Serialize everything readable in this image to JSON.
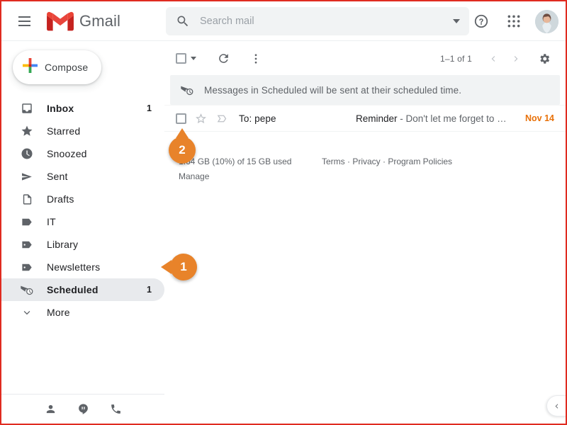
{
  "app": {
    "brand": "Gmail",
    "logo_color": "#d93025",
    "accent_orange": "#e8832a",
    "date_color": "#e8710a"
  },
  "header": {
    "menu_icon": "hamburger-icon",
    "logo_icon": "gmail-logo-icon",
    "search": {
      "icon": "search-icon",
      "placeholder": "Search mail",
      "value": "",
      "options_icon": "chevron-down-icon"
    },
    "help_icon": "help-icon",
    "apps_icon": "google-apps-grid-icon",
    "avatar_icon": "user-avatar"
  },
  "sidebar": {
    "compose": {
      "label": "Compose",
      "icon": "plus-icon"
    },
    "items": [
      {
        "label": "Inbox",
        "icon": "inbox-icon",
        "count": "1",
        "bold": true,
        "active": false
      },
      {
        "label": "Starred",
        "icon": "star-icon",
        "count": "",
        "bold": false,
        "active": false
      },
      {
        "label": "Snoozed",
        "icon": "clock-icon",
        "count": "",
        "bold": false,
        "active": false
      },
      {
        "label": "Sent",
        "icon": "send-icon",
        "count": "",
        "bold": false,
        "active": false
      },
      {
        "label": "Drafts",
        "icon": "draft-icon",
        "count": "",
        "bold": false,
        "active": false
      },
      {
        "label": "IT",
        "icon": "label-icon",
        "count": "",
        "bold": false,
        "active": false
      },
      {
        "label": "Library",
        "icon": "label-dot-icon",
        "count": "",
        "bold": false,
        "active": false
      },
      {
        "label": "Newsletters",
        "icon": "label-dot-icon",
        "count": "",
        "bold": false,
        "active": false
      },
      {
        "label": "Scheduled",
        "icon": "scheduled-icon",
        "count": "1",
        "bold": true,
        "active": true
      },
      {
        "label": "More",
        "icon": "chevron-down-icon",
        "count": "",
        "bold": false,
        "active": false
      }
    ],
    "bottom_icons": [
      {
        "name": "contacts-icon"
      },
      {
        "name": "hangouts-icon"
      },
      {
        "name": "phone-icon"
      }
    ]
  },
  "toolbar": {
    "select_all_icon": "checkbox-icon",
    "select_all_caret": "chevron-down-icon",
    "refresh_icon": "refresh-icon",
    "more_icon": "more-vertical-icon",
    "page_count": "1–1 of 1",
    "prev_icon": "chevron-left-icon",
    "next_icon": "chevron-right-icon",
    "settings_icon": "gear-icon"
  },
  "banner": {
    "icon": "scheduled-icon",
    "text": "Messages in Scheduled will be sent at their scheduled time."
  },
  "mail": {
    "row": {
      "checkbox_icon": "checkbox-icon",
      "star_icon": "star-outline-icon",
      "important_icon": "important-marker-icon",
      "recipient": "To: pepe",
      "subject": "Reminder",
      "snippet": " - Don't let me forget to …",
      "date": "Nov 14"
    }
  },
  "footer": {
    "storage": "1.64 GB (10%) of 15 GB used",
    "manage": "Manage",
    "links": "Terms · Privacy · Program Policies"
  },
  "callouts": [
    {
      "id": "1",
      "label": "1",
      "target": "sidebar-item-scheduled"
    },
    {
      "id": "2",
      "label": "2",
      "target": "mail-row-checkbox"
    }
  ],
  "expander": {
    "icon": "chevron-left-icon"
  }
}
